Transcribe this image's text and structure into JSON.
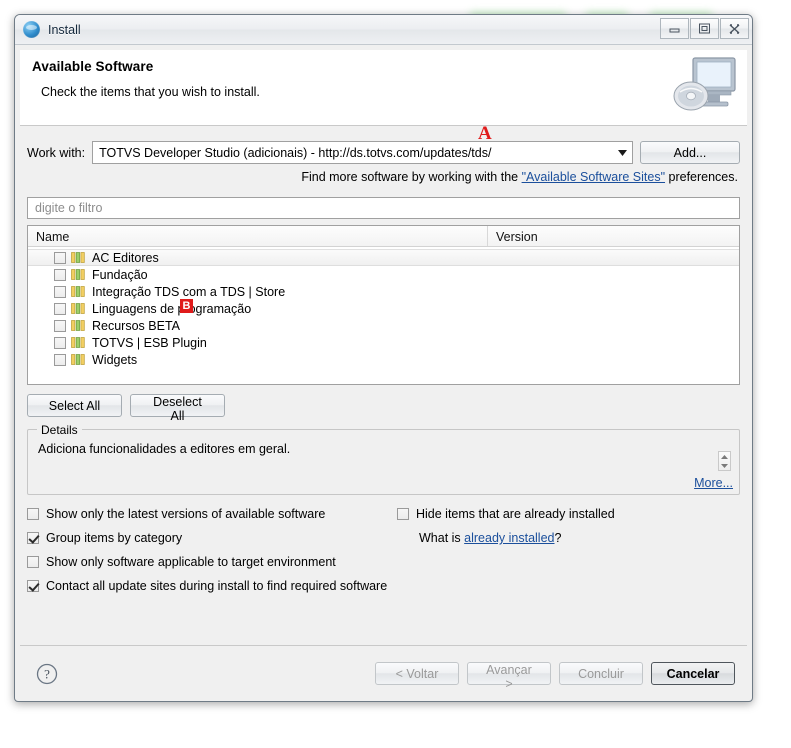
{
  "window": {
    "title": "Install",
    "icon": "install-globe-icon",
    "controls": {
      "minimize": "minimize-icon",
      "maximize": "maximize-icon",
      "close": "close-icon"
    }
  },
  "banner": {
    "title": "Available Software",
    "subtitle": "Check the items that you wish to install.",
    "image": "monitor-disc-icon"
  },
  "work_with": {
    "label": "Work with:",
    "value": "TOTVS Developer Studio (adicionais) - http://ds.totvs.com/updates/tds/",
    "add_label": "Add..."
  },
  "find_more": {
    "prefix": "Find more software by working with the ",
    "link": "\"Available Software Sites\"",
    "suffix": " preferences."
  },
  "filter": {
    "placeholder": "digite o filtro",
    "value": ""
  },
  "table": {
    "columns": [
      "Name",
      "Version"
    ],
    "rows": [
      {
        "name": "AC Editores",
        "version": "",
        "checked": false,
        "selected": true
      },
      {
        "name": "Fundação",
        "version": "",
        "checked": false,
        "selected": false
      },
      {
        "name": "Integração TDS com a TDS | Store",
        "version": "",
        "checked": false,
        "selected": false
      },
      {
        "name": "Linguagens de programação",
        "version": "",
        "checked": false,
        "selected": false
      },
      {
        "name": "Recursos BETA",
        "version": "",
        "checked": false,
        "selected": false
      },
      {
        "name": "TOTVS | ESB Plugin",
        "version": "",
        "checked": false,
        "selected": false
      },
      {
        "name": "Widgets",
        "version": "",
        "checked": false,
        "selected": false
      }
    ]
  },
  "selection_buttons": {
    "select_all": "Select All",
    "deselect_all": "Deselect All"
  },
  "details": {
    "legend": "Details",
    "text": "Adiciona funcionalidades a editores em geral.",
    "more_link": "More..."
  },
  "options": {
    "left": [
      {
        "label": "Show only the latest versions of available software",
        "checked": false
      },
      {
        "label": "Group items by category",
        "checked": true
      },
      {
        "label": "Show only software applicable to target environment",
        "checked": false
      },
      {
        "label": "Contact all update sites during install to find required software",
        "checked": true
      }
    ],
    "right": [
      {
        "label": "Hide items that are already installed",
        "checked": false
      }
    ],
    "what_is": {
      "prefix": "What is ",
      "link": "already installed",
      "suffix": "?"
    }
  },
  "footer": {
    "help": "help-icon",
    "buttons": [
      {
        "label": "< Voltar",
        "disabled": true,
        "default": false
      },
      {
        "label": "Avançar >",
        "disabled": true,
        "default": false
      },
      {
        "label": "Concluir",
        "disabled": true,
        "default": false
      },
      {
        "label": "Cancelar",
        "disabled": false,
        "default": true
      }
    ]
  },
  "annotations": [
    {
      "label": "A",
      "style": "letter"
    },
    {
      "label": "B",
      "style": "badge"
    }
  ],
  "colors": {
    "link": "#1b4f9c",
    "annotation": "#e01b1b",
    "window_border": "#6f7b86"
  }
}
